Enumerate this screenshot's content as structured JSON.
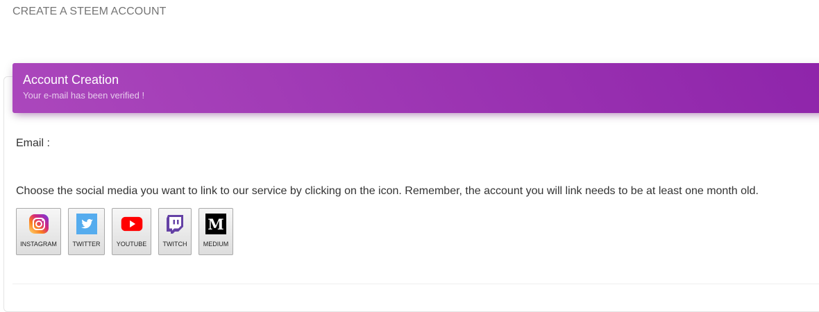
{
  "page": {
    "title": "CREATE A STEEM ACCOUNT"
  },
  "card": {
    "header_title": "Account Creation",
    "header_subtitle": "Your e-mail has been verified !"
  },
  "form": {
    "email_label": "Email :",
    "instruction": "Choose the social media you want to link to our service by clicking on the icon. Remember, the account you will link needs to be at least one month old."
  },
  "social": [
    {
      "label": "INSTAGRAM",
      "icon": "instagram-icon"
    },
    {
      "label": "TWITTER",
      "icon": "twitter-icon"
    },
    {
      "label": "YOUTUBE",
      "icon": "youtube-icon"
    },
    {
      "label": "TWITCH",
      "icon": "twitch-icon"
    },
    {
      "label": "MEDIUM",
      "icon": "medium-icon"
    }
  ],
  "colors": {
    "header_start": "#ab47bc",
    "header_end": "#8e24aa",
    "twitter": "#55acee",
    "youtube": "#ff0000",
    "twitch": "#6441a5",
    "medium": "#000000"
  }
}
